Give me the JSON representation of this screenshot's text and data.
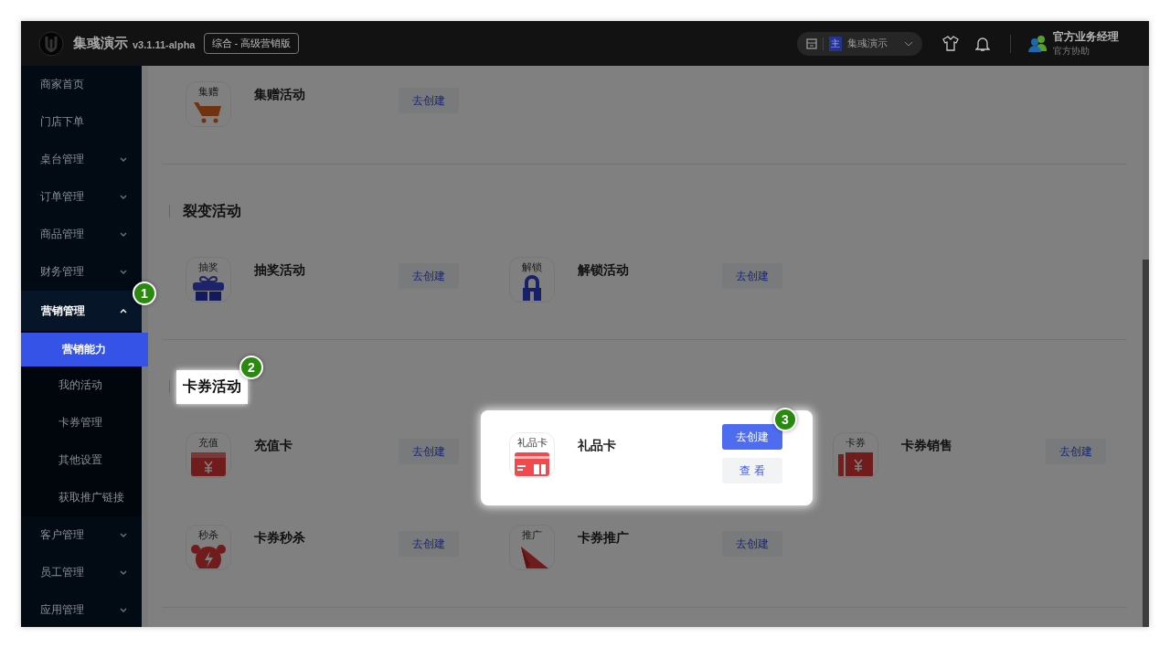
{
  "header": {
    "brand": "集彧演示",
    "version": "v3.1.11-alpha",
    "edition": "综合 - 高级营销版",
    "store": {
      "tag": "主",
      "name": "集彧演示"
    },
    "user": {
      "name": "官方业务经理",
      "role": "官方协助"
    }
  },
  "sidebar": {
    "items": [
      {
        "label": "商家首页",
        "expandable": false,
        "expanded": false
      },
      {
        "label": "门店下单",
        "expandable": false,
        "expanded": false
      },
      {
        "label": "桌台管理",
        "expandable": true,
        "expanded": false
      },
      {
        "label": "订单管理",
        "expandable": true,
        "expanded": false
      },
      {
        "label": "商品管理",
        "expandable": true,
        "expanded": false
      },
      {
        "label": "财务管理",
        "expandable": true,
        "expanded": false
      },
      {
        "label": "营销管理",
        "expandable": true,
        "expanded": true,
        "callout": "1",
        "children": [
          {
            "label": "营销能力",
            "selected": true
          },
          {
            "label": "我的活动",
            "selected": false
          },
          {
            "label": "卡券管理",
            "selected": false
          },
          {
            "label": "其他设置",
            "selected": false
          },
          {
            "label": "获取推广链接",
            "selected": false
          }
        ]
      },
      {
        "label": "客户管理",
        "expandable": true,
        "expanded": false
      },
      {
        "label": "员工管理",
        "expandable": true,
        "expanded": false
      },
      {
        "label": "应用管理",
        "expandable": true,
        "expanded": false
      }
    ]
  },
  "sections": [
    {
      "items": [
        {
          "kind": "cart",
          "icon_label": "集赠",
          "name": "集赠活动",
          "highlighted": false,
          "buttons": [
            {
              "label": "去创建",
              "kind": "plain"
            }
          ]
        }
      ]
    },
    {
      "title": "裂变活动",
      "highlighted": false,
      "items": [
        {
          "kind": "gift",
          "icon_label": "抽奖",
          "name": "抽奖活动",
          "highlighted": false,
          "buttons": [
            {
              "label": "去创建",
              "kind": "plain"
            }
          ]
        },
        {
          "kind": "lock",
          "icon_label": "解锁",
          "name": "解锁活动",
          "highlighted": false,
          "buttons": [
            {
              "label": "去创建",
              "kind": "plain"
            }
          ]
        }
      ]
    },
    {
      "title": "卡券活动",
      "highlighted": true,
      "callout": "2",
      "items": [
        {
          "kind": "card",
          "icon_label": "充值",
          "name": "充值卡",
          "highlighted": false,
          "buttons": [
            {
              "label": "去创建",
              "kind": "plain"
            }
          ]
        },
        {
          "kind": "giftcard",
          "icon_label": "礼品卡",
          "name": "礼品卡",
          "highlighted": true,
          "callout": "3",
          "buttons": [
            {
              "label": "去创建",
              "kind": "primary"
            },
            {
              "label": "查 看",
              "kind": "plain"
            }
          ]
        },
        {
          "kind": "ticket",
          "icon_label": "卡券",
          "name": "卡券销售",
          "highlighted": false,
          "buttons": [
            {
              "label": "去创建",
              "kind": "plain"
            }
          ]
        },
        {
          "kind": "alarm",
          "icon_label": "秒杀",
          "name": "卡券秒杀",
          "highlighted": false,
          "buttons": [
            {
              "label": "去创建",
              "kind": "plain"
            }
          ]
        },
        {
          "kind": "plane",
          "icon_label": "推广",
          "name": "卡券推广",
          "highlighted": false,
          "buttons": [
            {
              "label": "去创建",
              "kind": "plain"
            }
          ]
        }
      ]
    }
  ]
}
